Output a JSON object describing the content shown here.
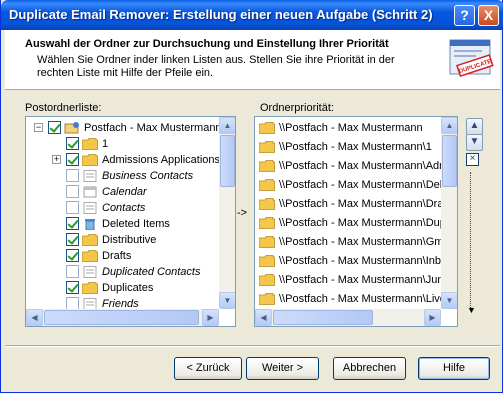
{
  "window": {
    "title": "Duplicate Email Remover: Erstellung einer neuen Aufgabe (Schritt 2)",
    "help_button": "?",
    "close_button": "X"
  },
  "header": {
    "title": "Auswahl der Ordner zur Durchsuchung und Einstellung Ihrer Priorität",
    "description": "Wählen Sie Ordner inder linken Listen aus. Stellen Sie ihre Priorität in der rechten Liste mit Hilfe der Pfeile ein.",
    "icon": "duplicate-stamp-icon",
    "icon_text": "DUPLICATE"
  },
  "left": {
    "label": "Postordnerliste:",
    "items": [
      {
        "text": "Postfach - Max Mustermann",
        "checked": true,
        "indent": 0,
        "expander": "−",
        "italic": false,
        "icon": "mailbox-icon"
      },
      {
        "text": "1",
        "checked": true,
        "indent": 1,
        "expander": "",
        "italic": false,
        "icon": "folder-icon"
      },
      {
        "text": "Admissions Applications",
        "checked": true,
        "indent": 1,
        "expander": "+",
        "italic": false,
        "icon": "folder-icon"
      },
      {
        "text": "Business Contacts",
        "checked": false,
        "indent": 1,
        "expander": "",
        "italic": true,
        "icon": "contacts-icon"
      },
      {
        "text": "Calendar",
        "checked": false,
        "indent": 1,
        "expander": "",
        "italic": true,
        "icon": "calendar-icon"
      },
      {
        "text": "Contacts",
        "checked": false,
        "indent": 1,
        "expander": "",
        "italic": true,
        "icon": "contacts-icon"
      },
      {
        "text": "Deleted Items",
        "checked": true,
        "indent": 1,
        "expander": "",
        "italic": false,
        "icon": "trash-icon"
      },
      {
        "text": "Distributive",
        "checked": true,
        "indent": 1,
        "expander": "",
        "italic": false,
        "icon": "folder-icon"
      },
      {
        "text": "Drafts",
        "checked": true,
        "indent": 1,
        "expander": "",
        "italic": false,
        "icon": "folder-icon"
      },
      {
        "text": "Duplicated Contacts",
        "checked": false,
        "indent": 1,
        "expander": "",
        "italic": true,
        "icon": "contacts-icon"
      },
      {
        "text": "Duplicates",
        "checked": true,
        "indent": 1,
        "expander": "",
        "italic": false,
        "icon": "folder-icon"
      },
      {
        "text": "Friends",
        "checked": false,
        "indent": 1,
        "expander": "",
        "italic": true,
        "icon": "contacts-icon"
      }
    ]
  },
  "middle_arrow": "->",
  "right": {
    "label": "Ordnerpriorität:",
    "items": [
      "\\\\Postfach - Max Mustermann",
      "\\\\Postfach - Max Mustermann\\1",
      "\\\\Postfach - Max Mustermann\\Adm",
      "\\\\Postfach - Max Mustermann\\Dele",
      "\\\\Postfach - Max Mustermann\\Draf",
      "\\\\Postfach - Max Mustermann\\Dup",
      "\\\\Postfach - Max Mustermann\\Gma",
      "\\\\Postfach - Max Mustermann\\Inbo",
      "\\\\Postfach - Max Mustermann\\Junl",
      "\\\\Postfach - Max Mustermann\\Live"
    ],
    "move_up": "▲",
    "move_down": "▼",
    "remove": "×",
    "small_arrow": "▼"
  },
  "buttons": {
    "back": "< Zurück",
    "next": "Weiter >",
    "cancel": "Abbrechen",
    "help": "Hilfe"
  },
  "colors": {
    "titlebar": "#0553d8",
    "folder": "#f4c64a",
    "check": "#21a121"
  }
}
